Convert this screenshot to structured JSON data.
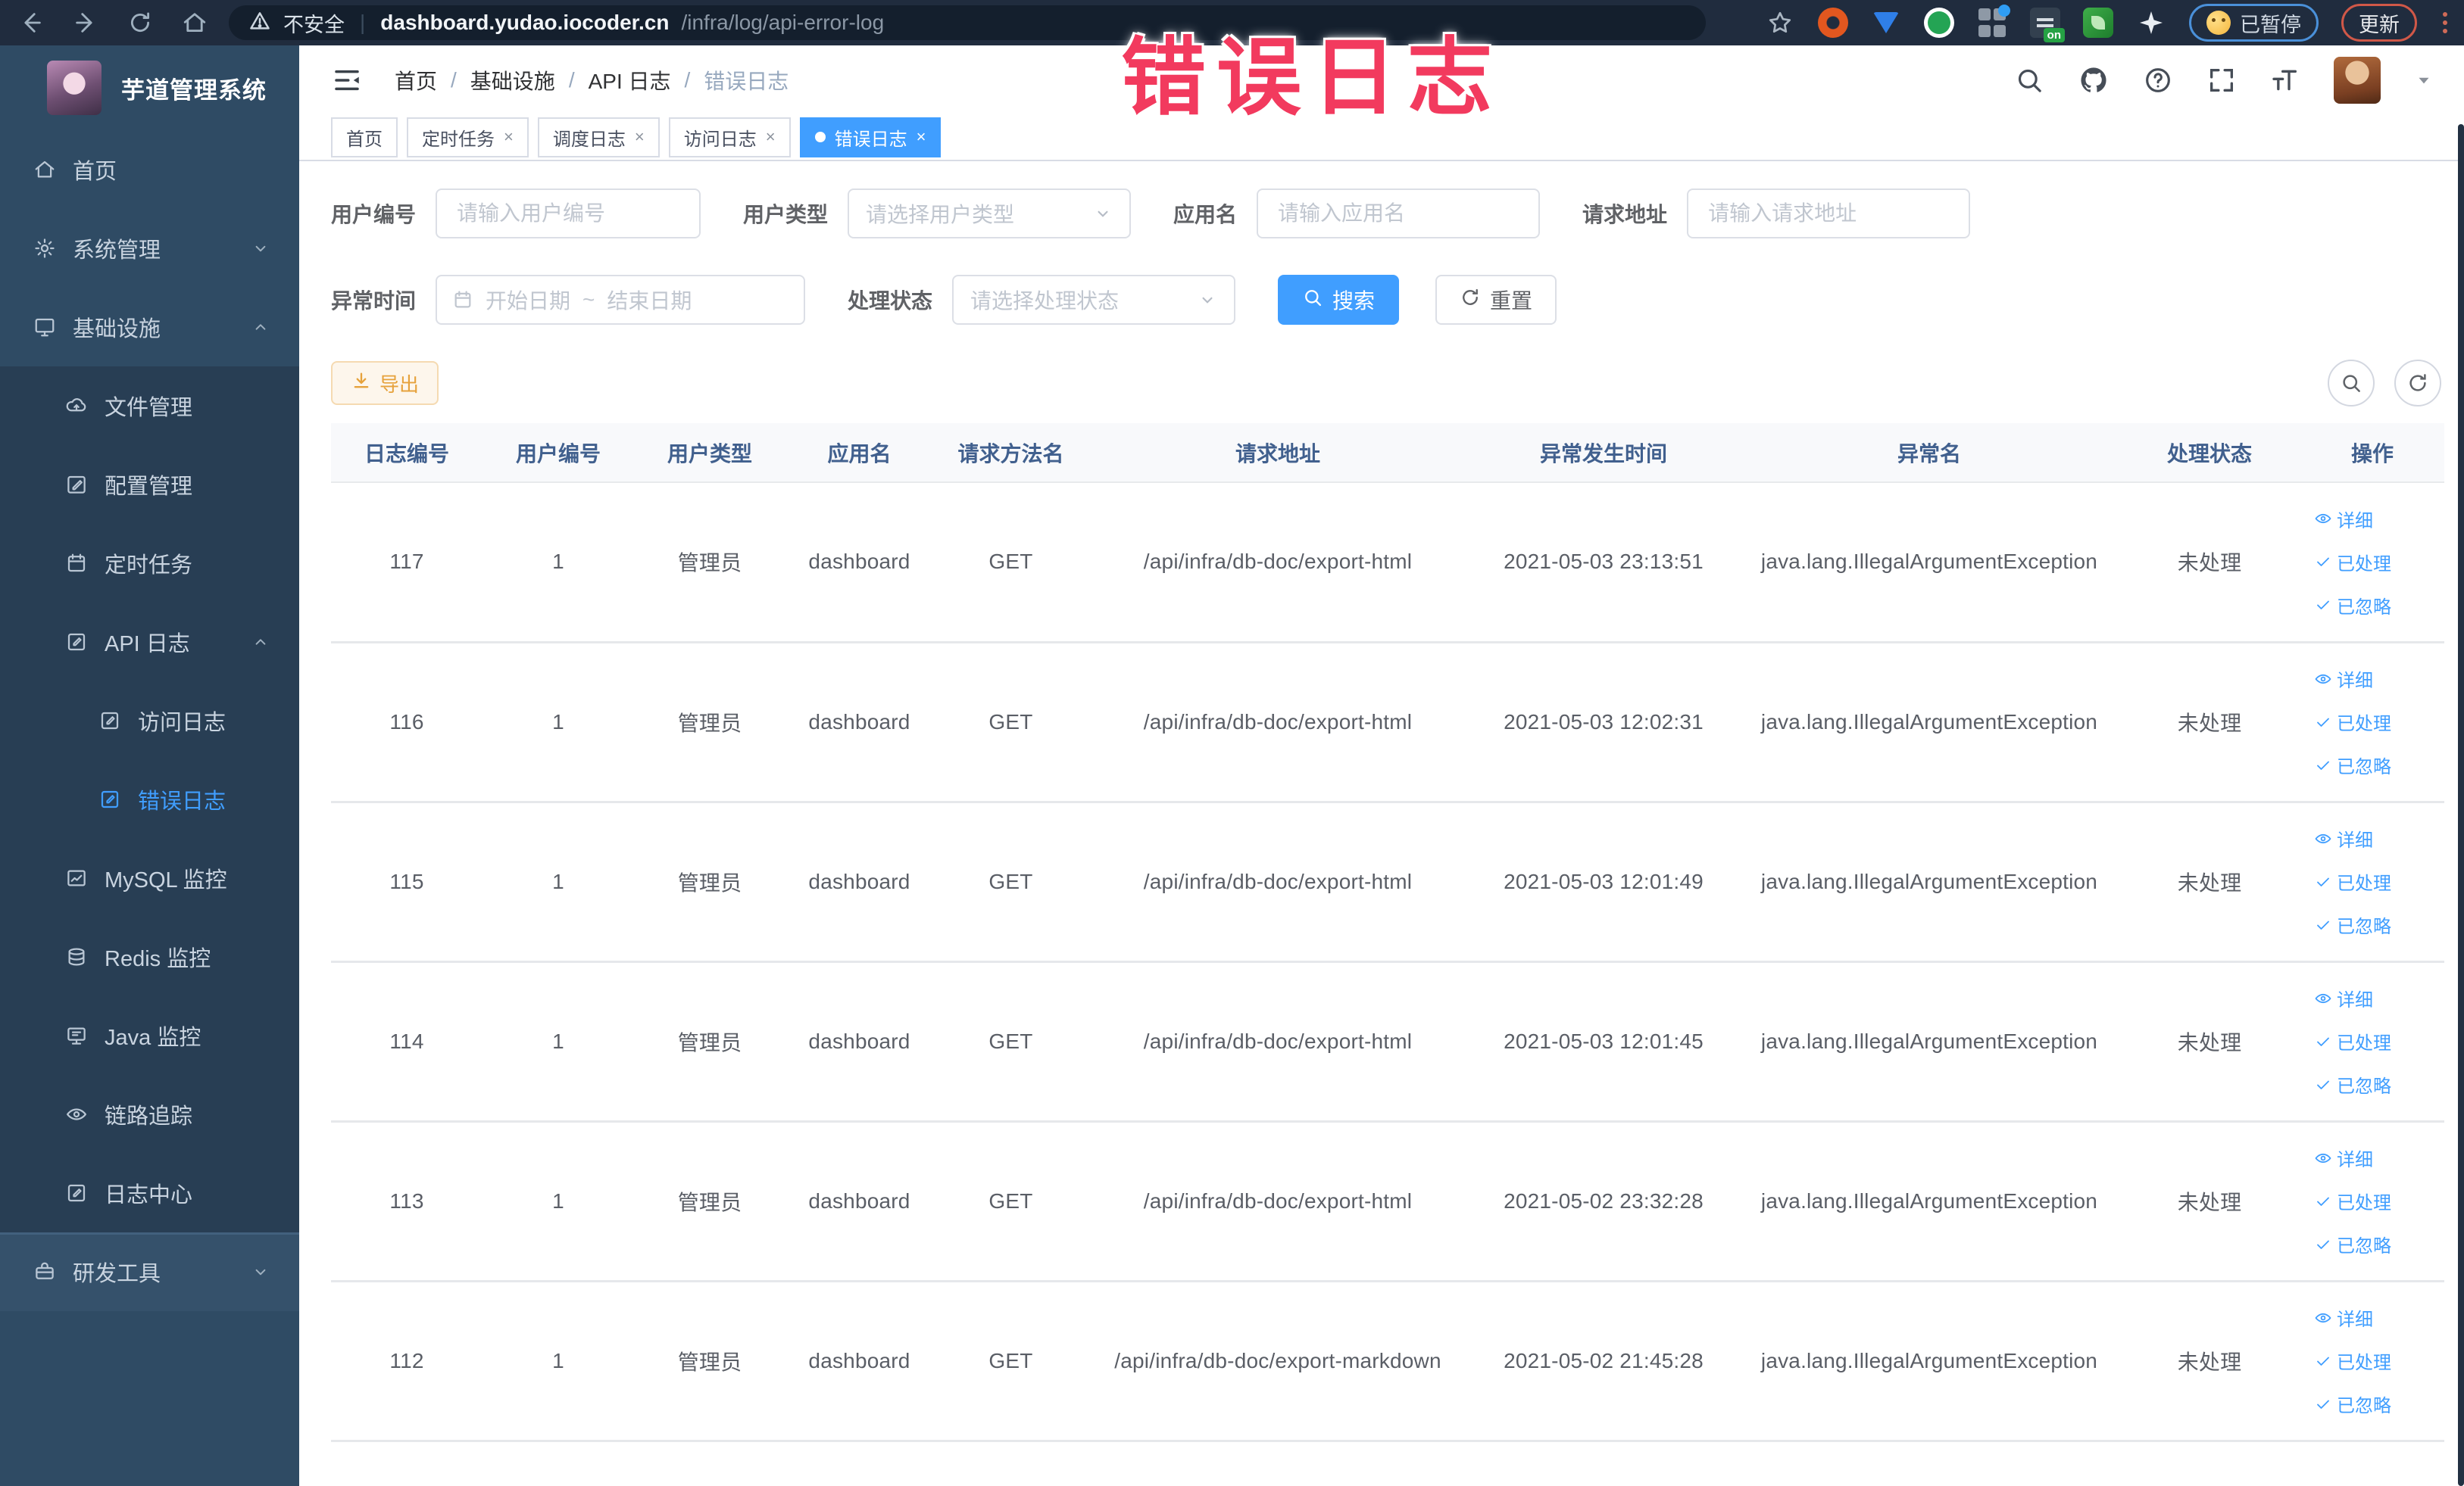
{
  "overlay": {
    "text": "错误日志"
  },
  "browser": {
    "security_label": "不安全",
    "url_host": "dashboard.yudao.iocoder.cn",
    "url_path": "/infra/log/api-error-log",
    "paused_badge": "已暂停",
    "update_button": "更新"
  },
  "sidebar": {
    "app_title": "芋道管理系统",
    "items": [
      {
        "label": "首页",
        "icon": "home-icon",
        "level": 1,
        "zone": "top",
        "chevron": ""
      },
      {
        "label": "系统管理",
        "icon": "gear-icon",
        "level": 1,
        "zone": "top",
        "chevron": "down"
      },
      {
        "label": "基础设施",
        "icon": "monitor-icon",
        "level": 1,
        "zone": "top",
        "chevron": "up"
      },
      {
        "label": "文件管理",
        "icon": "cloud-upload-icon",
        "level": 2,
        "zone": "sub",
        "chevron": ""
      },
      {
        "label": "配置管理",
        "icon": "edit-icon",
        "level": 2,
        "zone": "sub",
        "chevron": ""
      },
      {
        "label": "定时任务",
        "icon": "calendar-icon",
        "level": 2,
        "zone": "sub",
        "chevron": ""
      },
      {
        "label": "API 日志",
        "icon": "log-icon",
        "level": 2,
        "zone": "sub",
        "chevron": "up"
      },
      {
        "label": "访问日志",
        "icon": "log-icon",
        "level": 3,
        "zone": "sub",
        "chevron": ""
      },
      {
        "label": "错误日志",
        "icon": "log-icon",
        "level": 3,
        "zone": "sub",
        "chevron": "",
        "active": true
      },
      {
        "label": "MySQL 监控",
        "icon": "chart-icon",
        "level": 2,
        "zone": "sub",
        "chevron": ""
      },
      {
        "label": "Redis 监控",
        "icon": "database-icon",
        "level": 2,
        "zone": "sub",
        "chevron": ""
      },
      {
        "label": "Java 监控",
        "icon": "java-monitor-icon",
        "level": 2,
        "zone": "sub",
        "chevron": ""
      },
      {
        "label": "链路追踪",
        "icon": "trace-eye-icon",
        "level": 2,
        "zone": "sub",
        "chevron": ""
      },
      {
        "label": "日志中心",
        "icon": "log-icon",
        "level": 2,
        "zone": "sub",
        "chevron": ""
      },
      {
        "label": "研发工具",
        "icon": "toolbox-icon",
        "level": 1,
        "zone": "bottom",
        "chevron": "down"
      }
    ]
  },
  "breadcrumb": [
    "首页",
    "基础设施",
    "API 日志",
    "错误日志"
  ],
  "tabs": [
    {
      "label": "首页",
      "closable": false,
      "active": false
    },
    {
      "label": "定时任务",
      "closable": true,
      "active": false
    },
    {
      "label": "调度日志",
      "closable": true,
      "active": false
    },
    {
      "label": "访问日志",
      "closable": true,
      "active": false
    },
    {
      "label": "错误日志",
      "closable": true,
      "active": true
    }
  ],
  "filters": {
    "user_id": {
      "label": "用户编号",
      "placeholder": "请输入用户编号"
    },
    "user_type": {
      "label": "用户类型",
      "placeholder": "请选择用户类型"
    },
    "app_name": {
      "label": "应用名",
      "placeholder": "请输入应用名"
    },
    "request_url": {
      "label": "请求地址",
      "placeholder": "请输入请求地址"
    },
    "exception_time": {
      "label": "异常时间",
      "start_placeholder": "开始日期",
      "separator": "~",
      "end_placeholder": "结束日期"
    },
    "process_status": {
      "label": "处理状态",
      "placeholder": "请选择处理状态"
    },
    "search_button": "搜索",
    "reset_button": "重置"
  },
  "toolbar": {
    "export_label": "导出"
  },
  "table": {
    "columns": [
      "日志编号",
      "用户编号",
      "用户类型",
      "应用名",
      "请求方法名",
      "请求地址",
      "异常发生时间",
      "异常名",
      "处理状态",
      "操作"
    ],
    "rows": [
      {
        "id": "117",
        "user_id": "1",
        "user_type": "管理员",
        "app": "dashboard",
        "method": "GET",
        "url": "/api/infra/db-doc/export-html",
        "time": "2021-05-03 23:13:51",
        "exception": "java.lang.IllegalArgumentException",
        "status": "未处理"
      },
      {
        "id": "116",
        "user_id": "1",
        "user_type": "管理员",
        "app": "dashboard",
        "method": "GET",
        "url": "/api/infra/db-doc/export-html",
        "time": "2021-05-03 12:02:31",
        "exception": "java.lang.IllegalArgumentException",
        "status": "未处理"
      },
      {
        "id": "115",
        "user_id": "1",
        "user_type": "管理员",
        "app": "dashboard",
        "method": "GET",
        "url": "/api/infra/db-doc/export-html",
        "time": "2021-05-03 12:01:49",
        "exception": "java.lang.IllegalArgumentException",
        "status": "未处理"
      },
      {
        "id": "114",
        "user_id": "1",
        "user_type": "管理员",
        "app": "dashboard",
        "method": "GET",
        "url": "/api/infra/db-doc/export-html",
        "time": "2021-05-03 12:01:45",
        "exception": "java.lang.IllegalArgumentException",
        "status": "未处理"
      },
      {
        "id": "113",
        "user_id": "1",
        "user_type": "管理员",
        "app": "dashboard",
        "method": "GET",
        "url": "/api/infra/db-doc/export-html",
        "time": "2021-05-02 23:32:28",
        "exception": "java.lang.IllegalArgumentException",
        "status": "未处理"
      },
      {
        "id": "112",
        "user_id": "1",
        "user_type": "管理员",
        "app": "dashboard",
        "method": "GET",
        "url": "/api/infra/db-doc/export-markdown",
        "time": "2021-05-02 21:45:28",
        "exception": "java.lang.IllegalArgumentException",
        "status": "未处理"
      }
    ],
    "row_actions": [
      "详细",
      "已处理",
      "已忽略"
    ]
  },
  "colors": {
    "accent": "#409eff",
    "warning": "#e6a23c",
    "annotation_pink": "#f23a5e",
    "sidebar_bg": "#2f4b64",
    "sidebar_submenu_bg": "#283e54",
    "sidebar_bottom_bg": "#35516b",
    "browser_bar_bg": "#202c3e",
    "table_header_text": "#41608e"
  }
}
